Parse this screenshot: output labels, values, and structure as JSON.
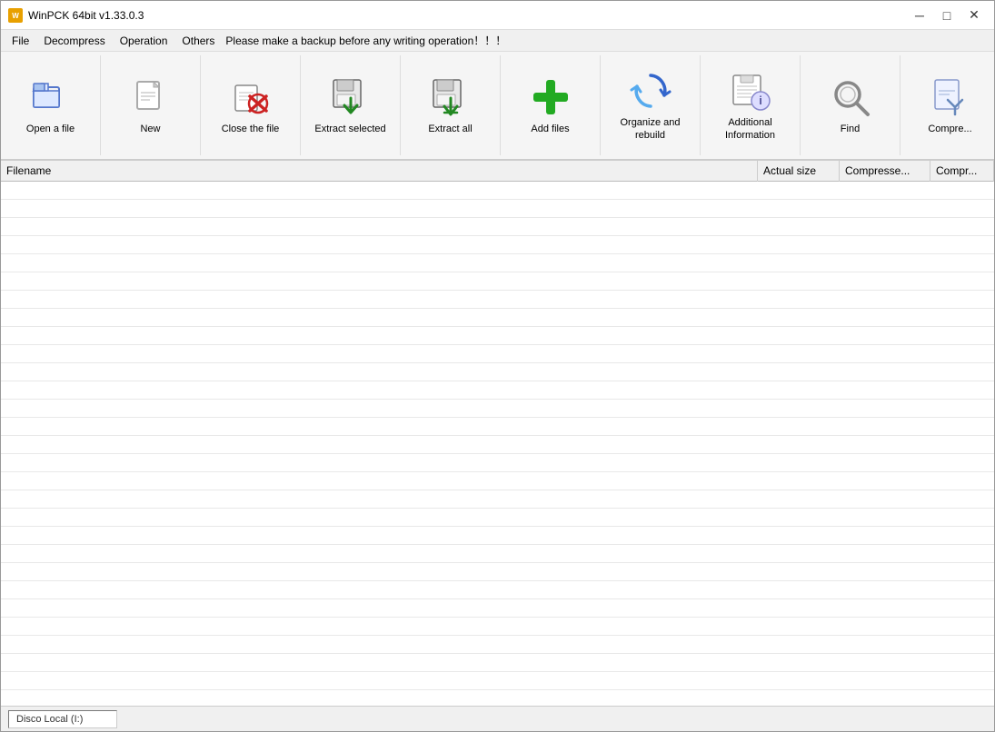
{
  "window": {
    "title": "WinPCK 64bit v1.33.0.3",
    "icon_label": "W"
  },
  "title_bar": {
    "minimize": "─",
    "maximize": "□",
    "close": "✕"
  },
  "menu": {
    "items": [
      {
        "id": "file",
        "label": "File"
      },
      {
        "id": "decompress",
        "label": "Decompress"
      },
      {
        "id": "operation",
        "label": "Operation"
      },
      {
        "id": "others",
        "label": "Others"
      }
    ],
    "notice": "Please make a backup before any writing operation！！！"
  },
  "toolbar": {
    "buttons": [
      {
        "id": "open-a-file",
        "label": "Open a file",
        "icon": "open"
      },
      {
        "id": "new",
        "label": "New",
        "icon": "new"
      },
      {
        "id": "close-the-file",
        "label": "Close the file",
        "icon": "close"
      },
      {
        "id": "extract-selected",
        "label": "Extract selected",
        "icon": "extract-sel"
      },
      {
        "id": "extract-all",
        "label": "Extract all",
        "icon": "extract-all"
      },
      {
        "id": "add-files",
        "label": "Add files",
        "icon": "add"
      },
      {
        "id": "organize-and-rebuild",
        "label": "Organize and rebuild",
        "icon": "organize"
      },
      {
        "id": "additional-information",
        "label": "Additional Information",
        "icon": "info"
      },
      {
        "id": "find",
        "label": "Find",
        "icon": "find"
      },
      {
        "id": "compress",
        "label": "Compre...",
        "icon": "compress"
      }
    ]
  },
  "file_table": {
    "columns": [
      {
        "id": "filename",
        "label": "Filename"
      },
      {
        "id": "actual-size",
        "label": "Actual size"
      },
      {
        "id": "compressed-size",
        "label": "Compresse..."
      },
      {
        "id": "compr",
        "label": "Compr..."
      }
    ],
    "rows": []
  },
  "status_bar": {
    "path": "Disco Local (I:)"
  }
}
